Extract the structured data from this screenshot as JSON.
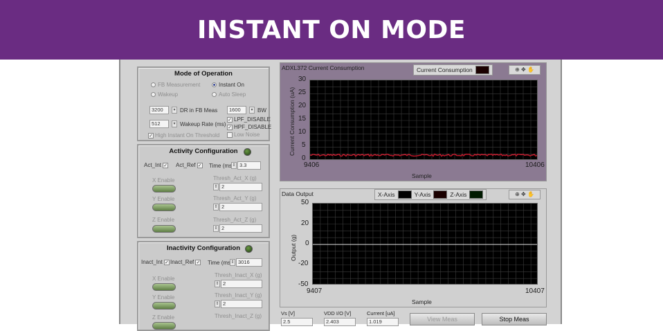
{
  "banner": {
    "title": "INSTANT ON MODE"
  },
  "mode_panel": {
    "title": "Mode of Operation",
    "options": [
      "FB Measurement",
      "Instant On",
      "Wakeup",
      "Auto Sleep"
    ],
    "selected": "Instant On",
    "dr_value": "3200",
    "dr_label": "DR in FB Meas",
    "bw_value": "1600",
    "bw_label": "BW",
    "wakeup_value": "512",
    "wakeup_label": "Wakeup Rate (ms)",
    "lpf_label": "LPF_DISABLE",
    "hpf_label": "HPF_DISABLE",
    "low_noise_label": "Low Noise",
    "threshold_label": "High Instant On Threshold"
  },
  "activity_panel": {
    "title": "Activity Configuration",
    "act_int": "Act_Int",
    "act_ref": "Act_Ref",
    "time_label": "Time (ms)",
    "time_value": "3.3",
    "x_enable": "X Enable",
    "y_enable": "Y Enable",
    "z_enable": "Z Enable",
    "thresh_x": "Thresh_Act_X (g)",
    "thresh_y": "Thresh_Act_Y (g)",
    "thresh_z": "Thresh_Act_Z (g)",
    "val_x": "2",
    "val_y": "2",
    "val_z": "2"
  },
  "inactivity_panel": {
    "title": "Inactivity Configuration",
    "inact_int": "Inact_Int",
    "inact_ref": "Inact_Ref",
    "time_label": "Time (ms)",
    "time_value": "3016",
    "x_enable": "X Enable",
    "y_enable": "Y Enable",
    "z_enable": "Z Enable",
    "thresh_x": "Thresh_Inact_X (g)",
    "thresh_y": "Thresh_Inact_Y (g)",
    "thresh_z": "Thresh_Inact_Z (g)",
    "val_x": "2",
    "val_y": "2"
  },
  "graph1": {
    "title": "ADXL372 Current Consumption",
    "legend": "Current Consumption",
    "ylabel": "Current Consumption (uA)",
    "xlabel": "Sample",
    "yticks": [
      "30",
      "25",
      "20",
      "15",
      "10",
      "5",
      "0"
    ],
    "xmin": "9406",
    "xmax": "10406"
  },
  "graph2": {
    "title": "Data Output",
    "legend": [
      "X-Axis",
      "Y-Axis",
      "Z-Axis"
    ],
    "ylabel": "Output (g)",
    "xlabel": "Sample",
    "yticks": [
      "50",
      "20",
      "0",
      "-20",
      "-50"
    ],
    "xmin": "9407",
    "xmax": "10407"
  },
  "tools_label": "⊕ ✥ ✋",
  "bottom": {
    "vs_label": "Vs [V]",
    "vs_value": "2.5",
    "vdd_label": "VDD I/O [V]",
    "vdd_value": "2.403",
    "current_label": "Current [uA]",
    "current_value": "1.019",
    "view_button": "View Meas",
    "stop_button": "Stop Meas"
  },
  "colors": {
    "banner": "#6a2c82",
    "trace": "#c0182a",
    "led": "#3d6b25"
  }
}
